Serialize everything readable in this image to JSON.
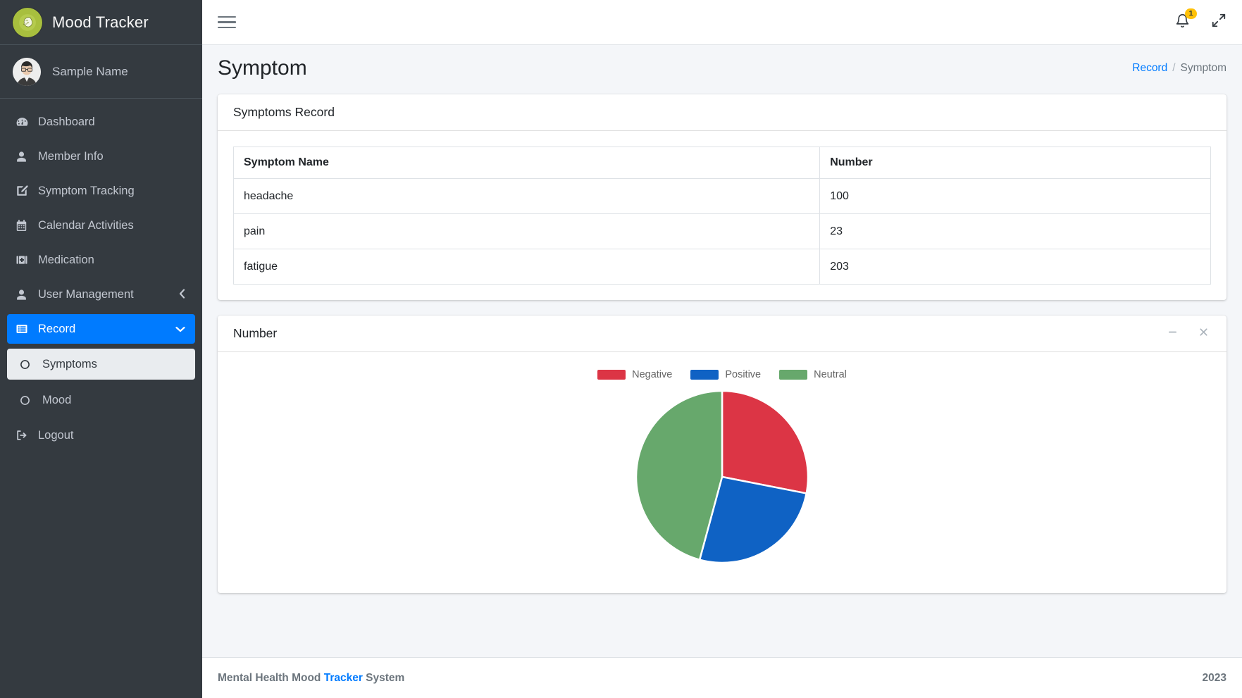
{
  "brand": {
    "name": "Mood Tracker",
    "logo_icon": "brain-head-icon"
  },
  "user": {
    "name": "Sample Name",
    "avatar_icon": "user-avatar"
  },
  "sidebar": {
    "items": [
      {
        "label": "Dashboard",
        "icon": "tachometer-icon"
      },
      {
        "label": "Member Info",
        "icon": "user-icon"
      },
      {
        "label": "Symptom Tracking",
        "icon": "edit-square-icon"
      },
      {
        "label": "Calendar Activities",
        "icon": "calendar-icon"
      },
      {
        "label": "Medication",
        "icon": "briefcase-medical-icon"
      },
      {
        "label": "User Management",
        "icon": "user-icon",
        "arrow": "‹"
      },
      {
        "label": "Record",
        "icon": "list-alt-icon",
        "arrow": "⌄",
        "active": true
      }
    ],
    "subitems": [
      {
        "label": "Symptoms",
        "icon": "circle-icon",
        "active": true
      },
      {
        "label": "Mood",
        "icon": "circle-icon",
        "active": false
      }
    ],
    "logout": {
      "label": "Logout",
      "icon": "sign-out-icon"
    }
  },
  "topbar": {
    "menu_toggle_icon": "hamburger-icon",
    "bell_icon": "bell-icon",
    "bell_badge": "1",
    "fullscreen_icon": "expand-arrows-icon"
  },
  "header": {
    "title": "Symptom",
    "breadcrumb": {
      "link": "Record",
      "separator": "/",
      "current": "Symptom"
    }
  },
  "table_card": {
    "title": "Symptoms Record",
    "columns": [
      "Symptom Name",
      "Number"
    ],
    "rows": [
      {
        "name": "headache",
        "number": "100"
      },
      {
        "name": "pain",
        "number": "23"
      },
      {
        "name": "fatigue",
        "number": "203"
      }
    ]
  },
  "chart_card": {
    "title": "Number",
    "minimize_icon": "minus-icon",
    "close_icon": "times-icon"
  },
  "chart_data": {
    "type": "pie",
    "title": "Number",
    "legend_position": "top",
    "labels": [
      "Negative",
      "Positive",
      "Neutral"
    ],
    "values": [
      100,
      93,
      163
    ],
    "percentages": [
      28,
      26,
      46
    ],
    "colors": [
      "#dc3545",
      "#0f62c4",
      "#67a86c"
    ],
    "start_angle_deg": 0,
    "slice_angles_deg": [
      101,
      95,
      164
    ]
  },
  "footer": {
    "text_before": "Mental Health Mood ",
    "accent": "Tracker",
    "text_after": " System",
    "year": "2023"
  },
  "colors": {
    "sidebar_bg": "#343a40",
    "accent_blue": "#007bff",
    "badge_yellow": "#ffc107",
    "negative_red": "#dc3545",
    "positive_blue": "#0f62c4",
    "neutral_green": "#67a86c"
  }
}
